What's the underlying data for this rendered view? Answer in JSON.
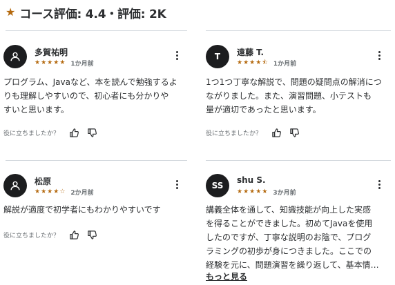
{
  "header": {
    "title": "コース評価: 4.4・評価: 2K"
  },
  "colors": {
    "star": "#b4690e",
    "avatar": "#1c1d1f",
    "divider": "#d1d7dc"
  },
  "feedback_prompt": "役に立ちましたか？",
  "show_more": "もっと見る",
  "reviews": [
    {
      "avatar": "person-icon",
      "avatar_initials": "",
      "name": "多賀祐明",
      "rating": 5,
      "date": "1か月前",
      "body": [
        "プログラム、Javaなど、本を読んで勉強するよ",
        "りも理解しやすいので、初心者にも分かりや",
        "すいと思います。"
      ]
    },
    {
      "avatar": "initials",
      "avatar_initials": "T",
      "name": "遠藤 T.",
      "rating": 4.5,
      "date": "1か月前",
      "body": [
        "1つ1つ丁寧な解説で、問題の疑問点の解消につ",
        "ながりました。また、演習問題、小テストも",
        "量が適切であったと思います。"
      ]
    },
    {
      "avatar": "person-icon",
      "avatar_initials": "",
      "name": "松原",
      "rating": 4,
      "date": "2か月前",
      "body": [
        "解説が適度で初学者にもわかりやすいです"
      ]
    },
    {
      "avatar": "initials",
      "avatar_initials": "SS",
      "name": "shu S.",
      "rating": 5,
      "date": "3か月前",
      "body": [
        "講義全体を通して、知識技能が向上した実感",
        "を得ることができました。初めてJavaを使用",
        "したのですが、丁寧な説明のお陰で、プログ",
        "ラミングの初歩が身につきました。ここでの",
        "経験を元に、問題演習を繰り返して、基本情…"
      ]
    }
  ]
}
